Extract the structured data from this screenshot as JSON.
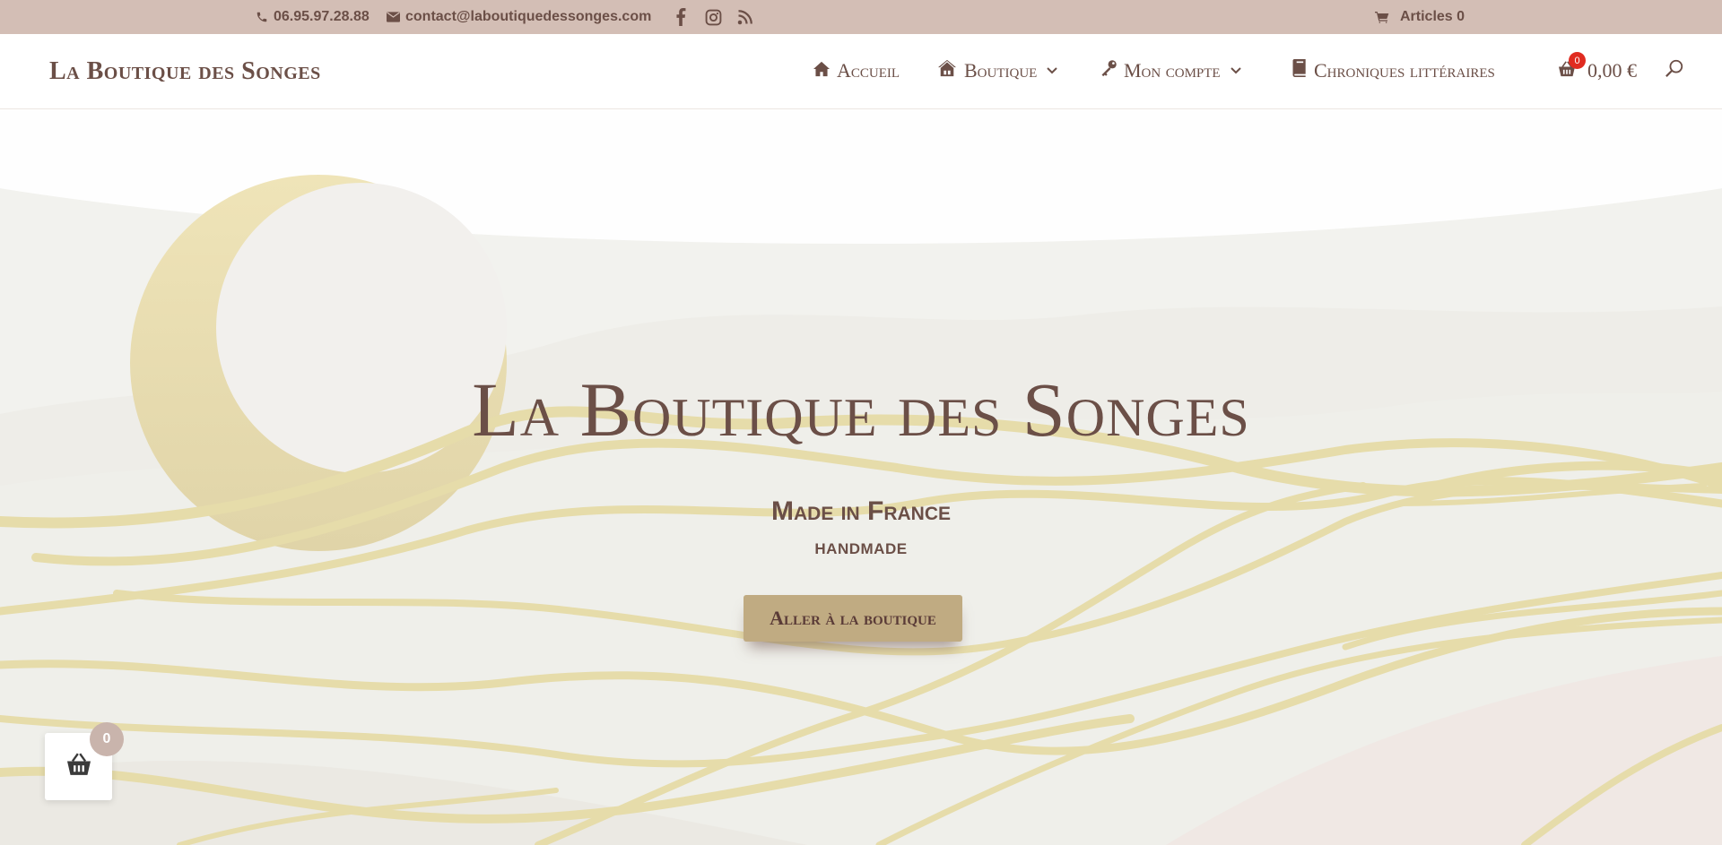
{
  "topbar": {
    "phone": "06.95.97.28.88",
    "email": "contact@laboutiquedessonges.com",
    "social": [
      "facebook-icon",
      "instagram-icon",
      "rss-icon"
    ],
    "cart_label": "Articles 0"
  },
  "header": {
    "logo": "La Boutique des Songes",
    "nav": [
      {
        "label": "Accueil",
        "icon": "home-icon"
      },
      {
        "label": "Boutique",
        "icon": "store-icon",
        "dropdown": true
      },
      {
        "label": "Mon compte",
        "icon": "key-icon",
        "dropdown": true
      },
      {
        "label": "Chroniques littéraires",
        "icon": "book-icon"
      }
    ],
    "cart_count": "0",
    "cart_total": "0,00 €"
  },
  "hero": {
    "title": "La Boutique des Songes",
    "subtitle1": "Made in France",
    "subtitle2": "handmade",
    "button": "Aller à la boutique"
  },
  "floating_cart": {
    "count": "0"
  },
  "colors": {
    "topbar": "#d3beb5",
    "text": "#6b4f47",
    "gold": "#e8dcb0",
    "button": "#c0ab82",
    "badge_red": "#e02b20"
  }
}
